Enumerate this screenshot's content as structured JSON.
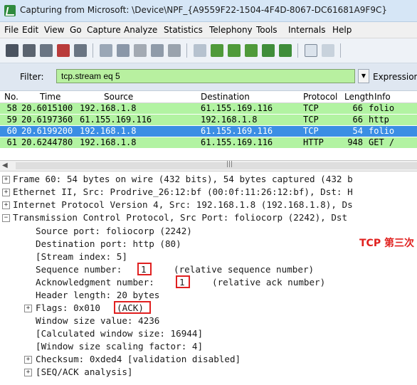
{
  "window": {
    "title": "Capturing from Microsoft: \\Device\\NPF_{A9559F22-1504-4F4D-8067-DC61681A9F9C}"
  },
  "menu": [
    "File",
    "Edit",
    "View",
    "Go",
    "Capture",
    "Analyze",
    "Statistics",
    "Telephony",
    "Tools",
    "Internals",
    "Help"
  ],
  "filter": {
    "label": "Filter:",
    "value": "tcp.stream eq 5",
    "expression_label": "Expression"
  },
  "packet_list": {
    "columns": [
      "No.",
      "Time",
      "Source",
      "Destination",
      "Protocol",
      "Length",
      "Info"
    ],
    "rows": [
      {
        "no": "58",
        "time": "20.6015100",
        "source": "192.168.1.8",
        "destination": "61.155.169.116",
        "protocol": "TCP",
        "length": "66",
        "info": "folio"
      },
      {
        "no": "59",
        "time": "20.6197360",
        "source": "61.155.169.116",
        "destination": "192.168.1.8",
        "protocol": "TCP",
        "length": "66",
        "info": "http"
      },
      {
        "no": "60",
        "time": "20.6199200",
        "source": "192.168.1.8",
        "destination": "61.155.169.116",
        "protocol": "TCP",
        "length": "54",
        "info": "folio"
      },
      {
        "no": "61",
        "time": "20.6244780",
        "source": "192.168.1.8",
        "destination": "61.155.169.116",
        "protocol": "HTTP",
        "length": "948",
        "info": "GET /"
      }
    ],
    "selected_index": 2
  },
  "details": {
    "frame": "Frame 60: 54 bytes on wire (432 bits), 54 bytes captured (432 b",
    "ethernet": "Ethernet II, Src: Prodrive_26:12:bf (00:0f:11:26:12:bf), Dst: H",
    "ip": "Internet Protocol Version 4, Src: 192.168.1.8 (192.168.1.8), Ds",
    "tcp": "Transmission Control Protocol, Src Port: foliocorp (2242), Dst",
    "src_port": "Source port: foliocorp (2242)",
    "dst_port": "Destination port: http (80)",
    "stream_index": "[Stream index: 5]",
    "seq_label": "Sequence number:",
    "seq_value": "1",
    "seq_note": "(relative sequence number)",
    "ack_label": "Acknowledgment number:",
    "ack_value": "1",
    "ack_note": "(relative ack number)",
    "header_length": "Header length: 20 bytes",
    "flags_label": "Flags: 0x010",
    "flags_value": "(ACK)",
    "window_size": "Window size value: 4236",
    "calc_window": "[Calculated window size: 16944]",
    "scaling": "[Window size scaling factor: 4]",
    "checksum": "Checksum: 0xded4 [validation disabled]",
    "seqack": "[SEQ/ACK analysis]"
  },
  "annotation": "TCP 第三次"
}
